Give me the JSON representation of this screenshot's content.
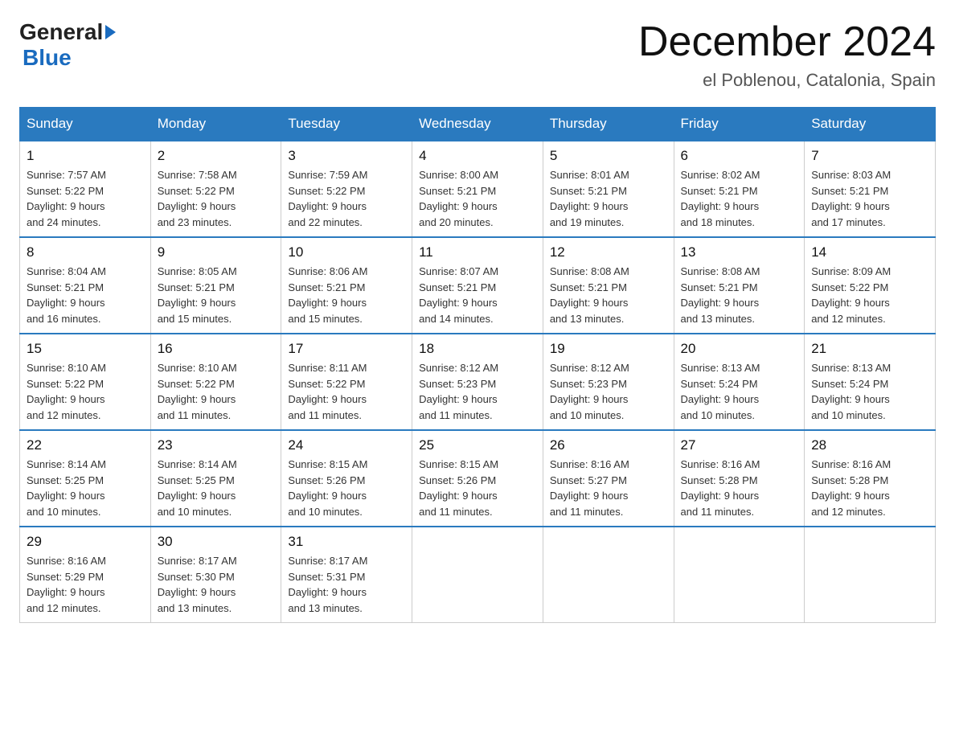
{
  "logo": {
    "line1": "General",
    "arrow": "▶",
    "line2": "Blue"
  },
  "title": "December 2024",
  "subtitle": "el Poblenou, Catalonia, Spain",
  "days_of_week": [
    "Sunday",
    "Monday",
    "Tuesday",
    "Wednesday",
    "Thursday",
    "Friday",
    "Saturday"
  ],
  "weeks": [
    [
      {
        "day": "1",
        "sunrise": "7:57 AM",
        "sunset": "5:22 PM",
        "daylight": "9 hours and 24 minutes."
      },
      {
        "day": "2",
        "sunrise": "7:58 AM",
        "sunset": "5:22 PM",
        "daylight": "9 hours and 23 minutes."
      },
      {
        "day": "3",
        "sunrise": "7:59 AM",
        "sunset": "5:22 PM",
        "daylight": "9 hours and 22 minutes."
      },
      {
        "day": "4",
        "sunrise": "8:00 AM",
        "sunset": "5:21 PM",
        "daylight": "9 hours and 20 minutes."
      },
      {
        "day": "5",
        "sunrise": "8:01 AM",
        "sunset": "5:21 PM",
        "daylight": "9 hours and 19 minutes."
      },
      {
        "day": "6",
        "sunrise": "8:02 AM",
        "sunset": "5:21 PM",
        "daylight": "9 hours and 18 minutes."
      },
      {
        "day": "7",
        "sunrise": "8:03 AM",
        "sunset": "5:21 PM",
        "daylight": "9 hours and 17 minutes."
      }
    ],
    [
      {
        "day": "8",
        "sunrise": "8:04 AM",
        "sunset": "5:21 PM",
        "daylight": "9 hours and 16 minutes."
      },
      {
        "day": "9",
        "sunrise": "8:05 AM",
        "sunset": "5:21 PM",
        "daylight": "9 hours and 15 minutes."
      },
      {
        "day": "10",
        "sunrise": "8:06 AM",
        "sunset": "5:21 PM",
        "daylight": "9 hours and 15 minutes."
      },
      {
        "day": "11",
        "sunrise": "8:07 AM",
        "sunset": "5:21 PM",
        "daylight": "9 hours and 14 minutes."
      },
      {
        "day": "12",
        "sunrise": "8:08 AM",
        "sunset": "5:21 PM",
        "daylight": "9 hours and 13 minutes."
      },
      {
        "day": "13",
        "sunrise": "8:08 AM",
        "sunset": "5:21 PM",
        "daylight": "9 hours and 13 minutes."
      },
      {
        "day": "14",
        "sunrise": "8:09 AM",
        "sunset": "5:22 PM",
        "daylight": "9 hours and 12 minutes."
      }
    ],
    [
      {
        "day": "15",
        "sunrise": "8:10 AM",
        "sunset": "5:22 PM",
        "daylight": "9 hours and 12 minutes."
      },
      {
        "day": "16",
        "sunrise": "8:10 AM",
        "sunset": "5:22 PM",
        "daylight": "9 hours and 11 minutes."
      },
      {
        "day": "17",
        "sunrise": "8:11 AM",
        "sunset": "5:22 PM",
        "daylight": "9 hours and 11 minutes."
      },
      {
        "day": "18",
        "sunrise": "8:12 AM",
        "sunset": "5:23 PM",
        "daylight": "9 hours and 11 minutes."
      },
      {
        "day": "19",
        "sunrise": "8:12 AM",
        "sunset": "5:23 PM",
        "daylight": "9 hours and 10 minutes."
      },
      {
        "day": "20",
        "sunrise": "8:13 AM",
        "sunset": "5:24 PM",
        "daylight": "9 hours and 10 minutes."
      },
      {
        "day": "21",
        "sunrise": "8:13 AM",
        "sunset": "5:24 PM",
        "daylight": "9 hours and 10 minutes."
      }
    ],
    [
      {
        "day": "22",
        "sunrise": "8:14 AM",
        "sunset": "5:25 PM",
        "daylight": "9 hours and 10 minutes."
      },
      {
        "day": "23",
        "sunrise": "8:14 AM",
        "sunset": "5:25 PM",
        "daylight": "9 hours and 10 minutes."
      },
      {
        "day": "24",
        "sunrise": "8:15 AM",
        "sunset": "5:26 PM",
        "daylight": "9 hours and 10 minutes."
      },
      {
        "day": "25",
        "sunrise": "8:15 AM",
        "sunset": "5:26 PM",
        "daylight": "9 hours and 11 minutes."
      },
      {
        "day": "26",
        "sunrise": "8:16 AM",
        "sunset": "5:27 PM",
        "daylight": "9 hours and 11 minutes."
      },
      {
        "day": "27",
        "sunrise": "8:16 AM",
        "sunset": "5:28 PM",
        "daylight": "9 hours and 11 minutes."
      },
      {
        "day": "28",
        "sunrise": "8:16 AM",
        "sunset": "5:28 PM",
        "daylight": "9 hours and 12 minutes."
      }
    ],
    [
      {
        "day": "29",
        "sunrise": "8:16 AM",
        "sunset": "5:29 PM",
        "daylight": "9 hours and 12 minutes."
      },
      {
        "day": "30",
        "sunrise": "8:17 AM",
        "sunset": "5:30 PM",
        "daylight": "9 hours and 13 minutes."
      },
      {
        "day": "31",
        "sunrise": "8:17 AM",
        "sunset": "5:31 PM",
        "daylight": "9 hours and 13 minutes."
      },
      null,
      null,
      null,
      null
    ]
  ],
  "labels": {
    "sunrise": "Sunrise:",
    "sunset": "Sunset:",
    "daylight": "Daylight:"
  }
}
